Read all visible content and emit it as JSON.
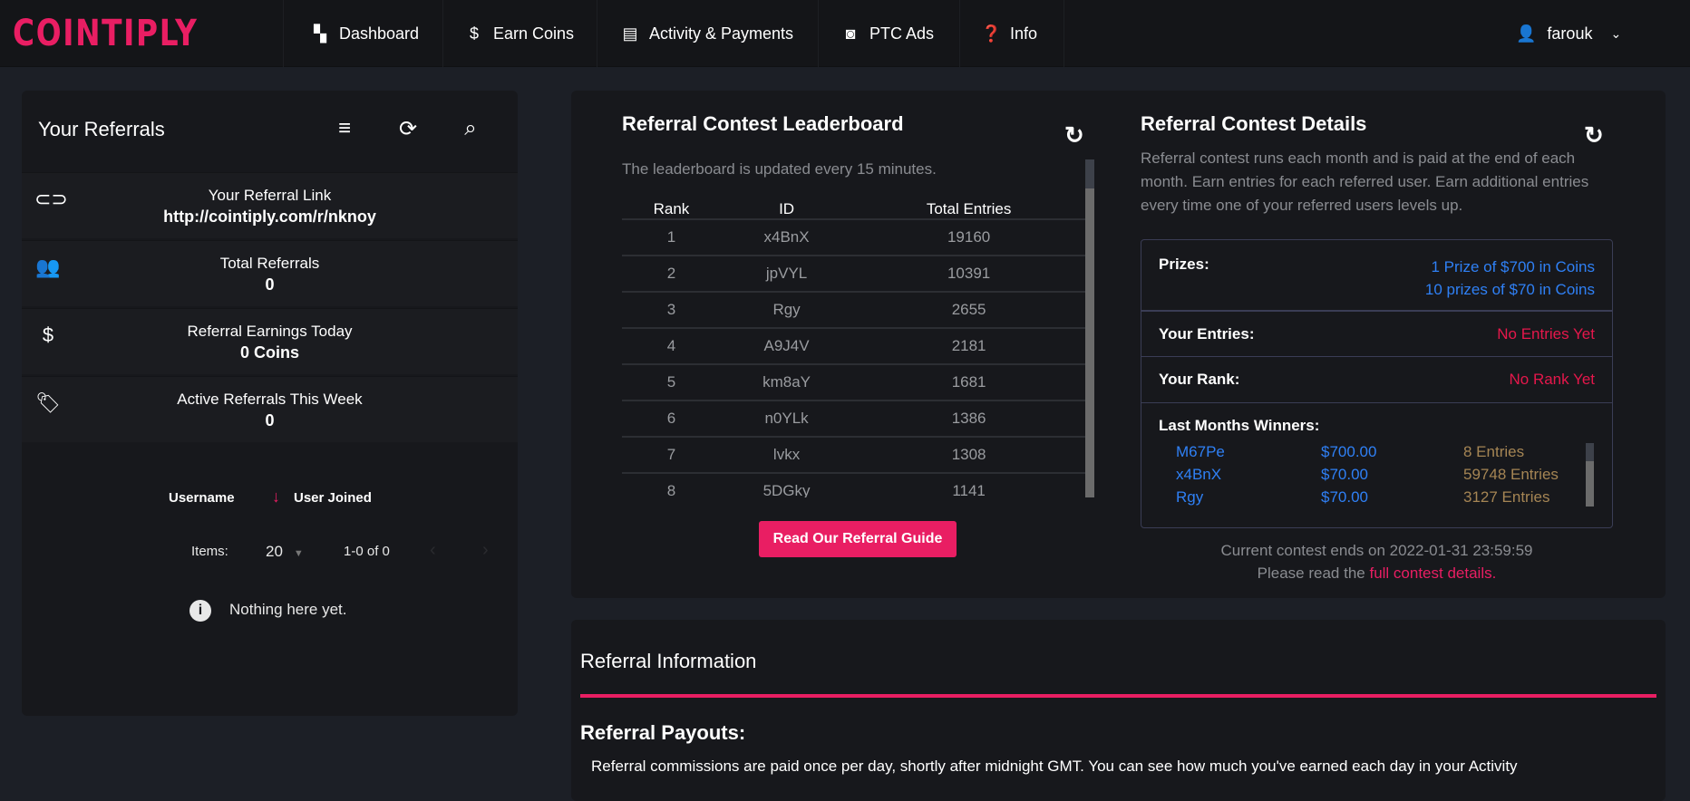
{
  "brand": {
    "logo": "COINTIPLY",
    "accent": "#e91e63"
  },
  "nav": {
    "items": [
      {
        "label": "Dashboard",
        "icon": "dashboard-icon"
      },
      {
        "label": "Earn Coins",
        "icon": "dollar-icon"
      },
      {
        "label": "Activity & Payments",
        "icon": "list-icon"
      },
      {
        "label": "PTC Ads",
        "icon": "search-box-icon"
      },
      {
        "label": "Info",
        "icon": "question-icon"
      }
    ],
    "user": "farouk"
  },
  "referrals": {
    "title": "Your Referrals",
    "stats": [
      {
        "label": "Your Referral Link",
        "value": "http://cointiply.com/r/nknoy",
        "icon": "link-icon"
      },
      {
        "label": "Total Referrals",
        "value": "0",
        "icon": "people-icon"
      },
      {
        "label": "Referral Earnings Today",
        "value": "0 Coins",
        "icon": "dollar-icon"
      },
      {
        "label": "Active Referrals This Week",
        "value": "0",
        "icon": "tag-heart-icon"
      }
    ],
    "table": {
      "col_username": "Username",
      "col_joined": "User Joined"
    },
    "pagination": {
      "items_label": "Items:",
      "per_page": "20",
      "range": "1-0 of 0"
    },
    "empty": "Nothing here yet."
  },
  "leaderboard": {
    "title": "Referral Contest Leaderboard",
    "subtitle": "The leaderboard is updated every 15 minutes.",
    "headers": [
      "Rank",
      "ID",
      "Total Entries"
    ],
    "rows": [
      [
        "1",
        "x4BnX",
        "19160"
      ],
      [
        "2",
        "jpVYL",
        "10391"
      ],
      [
        "3",
        "Rgy",
        "2655"
      ],
      [
        "4",
        "A9J4V",
        "2181"
      ],
      [
        "5",
        "km8aY",
        "1681"
      ],
      [
        "6",
        "n0YLk",
        "1386"
      ],
      [
        "7",
        "lvkx",
        "1308"
      ],
      [
        "8",
        "5DGky",
        "1141"
      ]
    ],
    "guide_button": "Read Our Referral Guide"
  },
  "details": {
    "title": "Referral Contest Details",
    "description": "Referral contest runs each month and is paid at the end of each month. Earn entries for each referred user. Earn additional entries every time one of your referred users levels up.",
    "prizes_label": "Prizes:",
    "prizes": [
      "1 Prize of $700 in Coins",
      "10 prizes of $70 in Coins"
    ],
    "entries_label": "Your Entries:",
    "entries_value": "No Entries Yet",
    "rank_label": "Your Rank:",
    "rank_value": "No Rank Yet",
    "winners_label": "Last Months Winners:",
    "winners": [
      [
        "M67Pe",
        "$700.00",
        "8 Entries"
      ],
      [
        "x4BnX",
        "$70.00",
        "59748 Entries"
      ],
      [
        "Rgy",
        "$70.00",
        "3127 Entries"
      ]
    ],
    "ends": "Current contest ends on 2022-01-31 23:59:59",
    "read_prefix": "Please read the ",
    "read_link": "full contest details."
  },
  "info": {
    "title": "Referral Information",
    "payouts_title": "Referral Payouts:",
    "payouts_text": "Referral commissions are paid once per day, shortly after midnight GMT. You can see how much you've earned each day in your Activity"
  }
}
